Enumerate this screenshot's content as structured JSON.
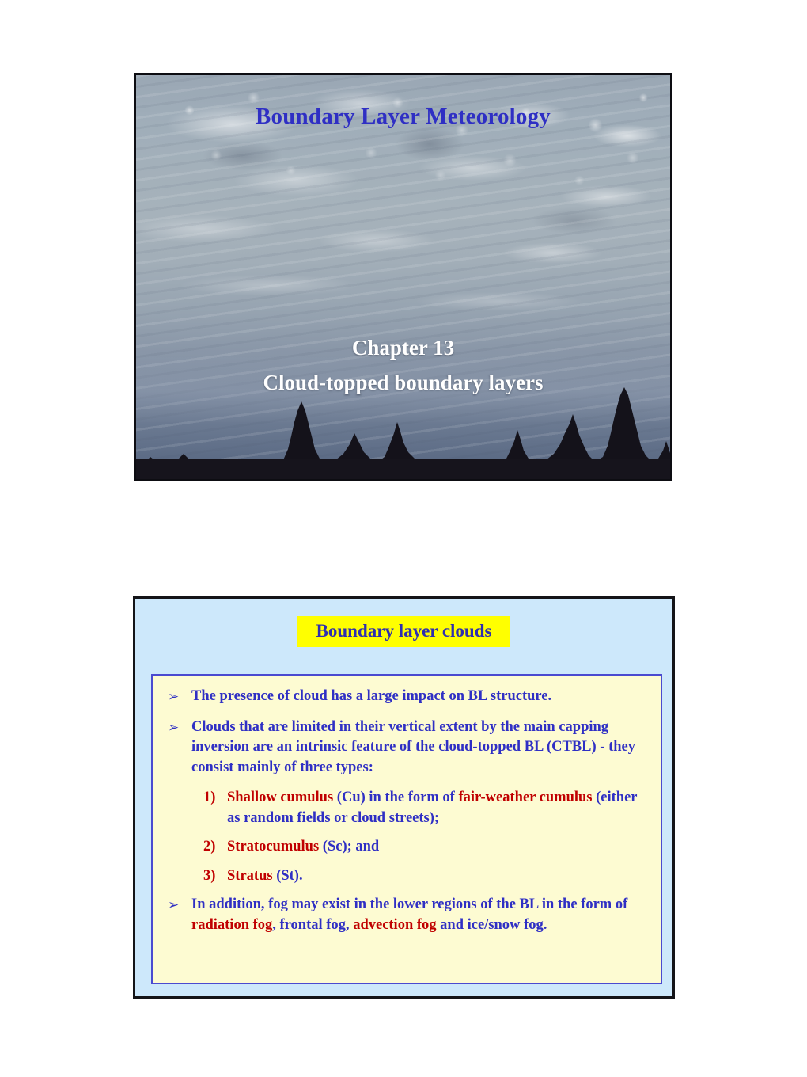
{
  "slide_1": {
    "title": "Boundary Layer Meteorology",
    "subtitle_line_1": "Chapter 13",
    "subtitle_line_2": "Cloud-topped boundary layers",
    "image_alt": "altocumulus-cloud-sky-photo",
    "title_color": "#2f2fc4",
    "subtitle_color": "#ffffff"
  },
  "slide_2": {
    "heading": "Boundary layer clouds",
    "heading_bg": "#ffff00",
    "heading_color": "#2f2fb0",
    "slide_bg": "#cde8fb",
    "panel_bg": "#fdfbd2",
    "panel_border": "#4a4ad0",
    "bullet_glyph": "➢",
    "bullets": [
      {
        "id": "bullet-1",
        "parts": [
          {
            "text": "The presence of cloud has a large impact on BL structure.",
            "color": "blue"
          }
        ]
      },
      {
        "id": "bullet-2",
        "parts": [
          {
            "text": "Clouds that are limited in their vertical extent by the main capping inversion are an intrinsic feature of the cloud-topped BL (CTBL) - they consist mainly of three types:",
            "color": "blue"
          }
        ]
      }
    ],
    "numbered_items": [
      {
        "id": "numbered-item-1",
        "marker": "1)",
        "parts": [
          {
            "text": "Shallow cumulus ",
            "color": "red"
          },
          {
            "text": "(Cu) in the form of ",
            "color": "blue"
          },
          {
            "text": "fair-weather cumulus ",
            "color": "red"
          },
          {
            "text": "(either as random fields or cloud streets);",
            "color": "blue"
          }
        ]
      },
      {
        "id": "numbered-item-2",
        "marker": "2)",
        "parts": [
          {
            "text": "Stratocumulus ",
            "color": "red"
          },
          {
            "text": "(Sc); and",
            "color": "blue"
          }
        ]
      },
      {
        "id": "numbered-item-3",
        "marker": "3)",
        "parts": [
          {
            "text": "Stratus ",
            "color": "red"
          },
          {
            "text": "(St).",
            "color": "blue"
          }
        ]
      }
    ],
    "bullets_after": [
      {
        "id": "bullet-3",
        "parts": [
          {
            "text": "In addition, fog may exist in the lower regions of the BL in the form of ",
            "color": "blue"
          },
          {
            "text": "radiation fog",
            "color": "red"
          },
          {
            "text": ", frontal fog, ",
            "color": "blue"
          },
          {
            "text": "advection fog",
            "color": "red"
          },
          {
            "text": " and ice/snow fog.",
            "color": "blue"
          }
        ]
      }
    ]
  }
}
